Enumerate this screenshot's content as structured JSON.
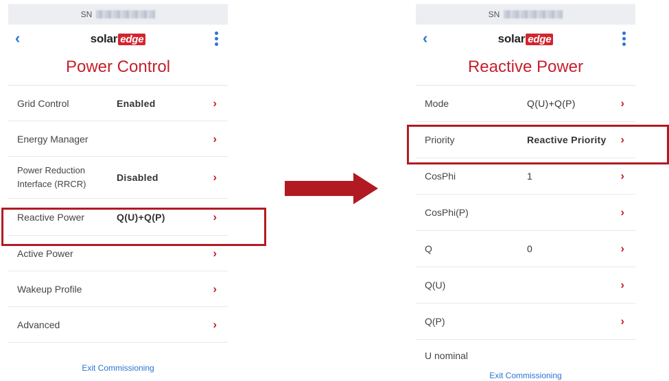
{
  "left_screen": {
    "sn_label": "SN",
    "logo_solar": "solar",
    "logo_edge": "edge",
    "title": "Power Control",
    "rows": [
      {
        "label": "Grid Control",
        "value": "Enabled"
      },
      {
        "label": "Energy Manager",
        "value": ""
      },
      {
        "label": "Power Reduction Interface (RRCR)",
        "value": "Disabled"
      },
      {
        "label": "Reactive Power",
        "value": "Q(U)+Q(P)"
      },
      {
        "label": "Active Power",
        "value": ""
      },
      {
        "label": "Wakeup Profile",
        "value": ""
      },
      {
        "label": "Advanced",
        "value": ""
      }
    ],
    "exit_label": "Exit Commissioning"
  },
  "right_screen": {
    "sn_label": "SN",
    "logo_solar": "solar",
    "logo_edge": "edge",
    "title": "Reactive Power",
    "rows": [
      {
        "label": "Mode",
        "value": "Q(U)+Q(P)"
      },
      {
        "label": "Priority",
        "value": "Reactive Priority"
      },
      {
        "label": "CosPhi",
        "value": "1"
      },
      {
        "label": "CosPhi(P)",
        "value": ""
      },
      {
        "label": "Q",
        "value": "0"
      },
      {
        "label": "Q(U)",
        "value": ""
      },
      {
        "label": "Q(P)",
        "value": ""
      },
      {
        "label": "U nominal",
        "value": ""
      }
    ],
    "exit_label": "Exit Commissioning"
  },
  "colors": {
    "brand_red": "#c5202e",
    "link_blue": "#2a73d6",
    "highlight_red": "#b11a22"
  },
  "icons": {
    "back": "chevron-left-icon",
    "menu": "vertical-dots-icon",
    "row_chevron": "chevron-right-icon",
    "transition": "arrow-right-icon"
  }
}
